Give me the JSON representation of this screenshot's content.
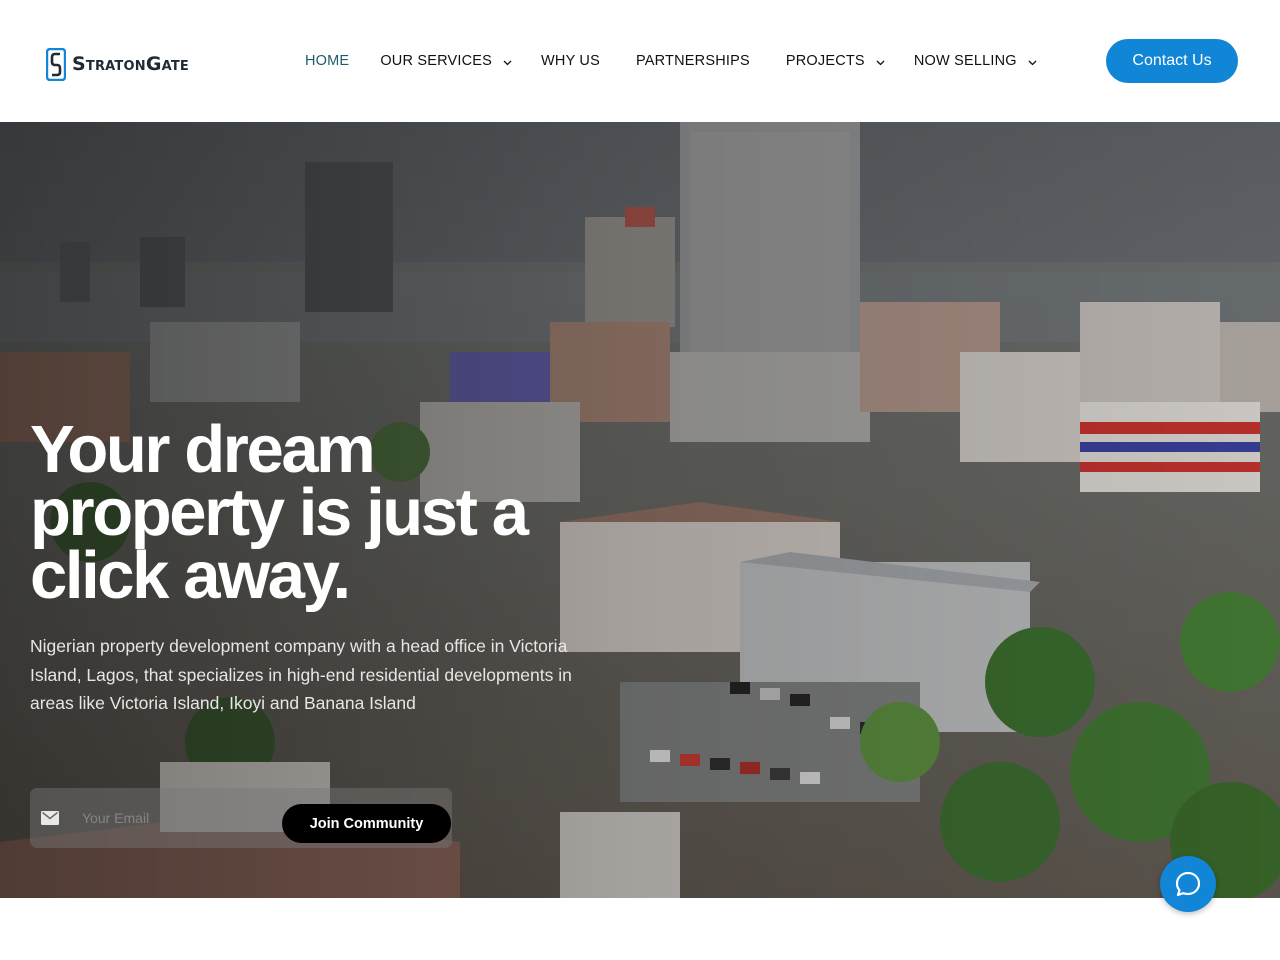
{
  "brand": {
    "name": "StratonGate",
    "logo_icon": "straton-s-logo-icon",
    "text_color": "#1f2a36",
    "mark_color": "#1185d6"
  },
  "nav": {
    "items": [
      {
        "label": "HOME",
        "active": true,
        "dropdown": false
      },
      {
        "label": "OUR SERVICES",
        "active": false,
        "dropdown": true
      },
      {
        "label": "WHY US",
        "active": false,
        "dropdown": false
      },
      {
        "label": "PARTNERSHIPS",
        "active": false,
        "dropdown": false
      },
      {
        "label": "PROJECTS",
        "active": false,
        "dropdown": true
      },
      {
        "label": "NOW SELLING",
        "active": false,
        "dropdown": true
      }
    ],
    "active_color": "#1b5d6b",
    "dropdown_icon": "chevron-down-icon"
  },
  "header": {
    "contact_label": "Contact Us",
    "accent": "#1185d6"
  },
  "hero": {
    "headline_lines": [
      "Your dream",
      "property is just a",
      "click away."
    ],
    "subtext": "Nigerian property development company with a head office in Victoria Island, Lagos, that specializes in high-end residential developments in areas like Victoria Island, Ikoyi  and Banana Island",
    "background_icon": "city-skyline-photo"
  },
  "subscribe": {
    "placeholder": "Your Email",
    "value": "",
    "button_label": "Join Community",
    "icon": "mail-icon"
  },
  "chat": {
    "icon": "chat-bubble-icon",
    "color": "#1185d6"
  }
}
